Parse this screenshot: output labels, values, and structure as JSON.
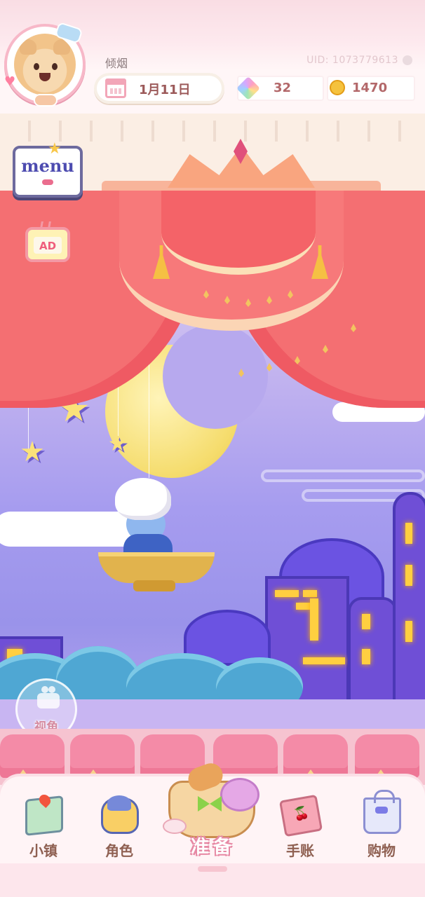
{
  "header": {
    "player_name": "倾烟",
    "uid": "UID: 1073779613",
    "date": "1月11日",
    "gems": "32",
    "coins": "1470"
  },
  "side_buttons": {
    "menu_label": "menu",
    "ad_label": "AD",
    "view_label": "视角"
  },
  "nav": {
    "town": "小镇",
    "role": "角色",
    "prepare": "准备",
    "notebook": "手账",
    "shop": "购物"
  },
  "colors": {
    "curtain": "#f46f72",
    "sky": "#a69cef",
    "accent_pink": "#f48ba7",
    "label_brown": "#8f6052"
  },
  "icons": {
    "calendar": "calendar-icon",
    "snowflake": "snowflake-icon",
    "gem": "rainbow-gem-icon",
    "coin": "gold-coin-icon",
    "copy": "copy-icon",
    "camera": "camera-icon",
    "town": "map-pin-icon",
    "role": "character-icon",
    "prepare": "picnic-basket-icon",
    "notebook": "cherry-notebook-icon",
    "shop": "shopping-bag-icon"
  }
}
